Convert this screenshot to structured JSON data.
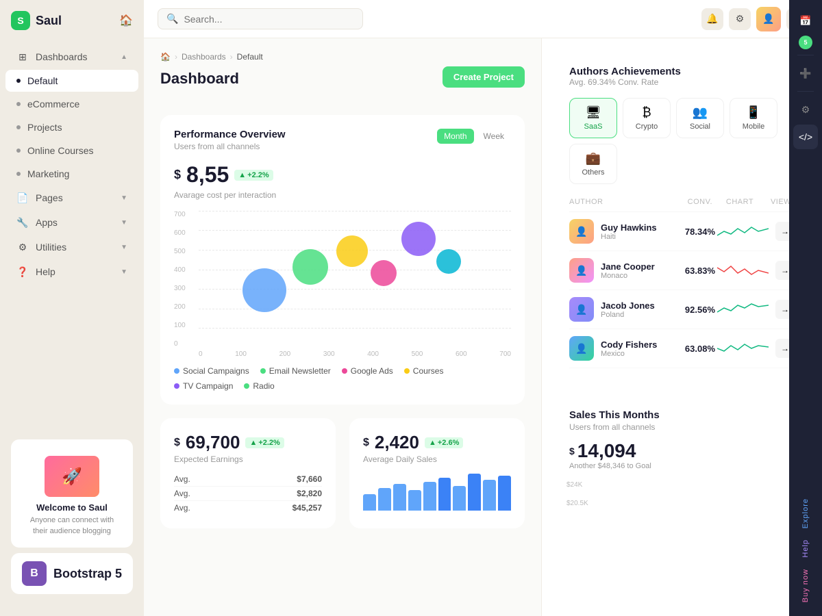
{
  "app": {
    "name": "Saul",
    "logo_letter": "S"
  },
  "sidebar": {
    "items": [
      {
        "id": "dashboards",
        "label": "Dashboards",
        "icon": "⊞",
        "type": "group",
        "expanded": true
      },
      {
        "id": "default",
        "label": "Default",
        "type": "child",
        "active": true
      },
      {
        "id": "ecommerce",
        "label": "eCommerce",
        "type": "child"
      },
      {
        "id": "projects",
        "label": "Projects",
        "type": "child"
      },
      {
        "id": "online-courses",
        "label": "Online Courses",
        "type": "child"
      },
      {
        "id": "marketing",
        "label": "Marketing",
        "type": "child"
      },
      {
        "id": "pages",
        "label": "Pages",
        "icon": "📄",
        "type": "group"
      },
      {
        "id": "apps",
        "label": "Apps",
        "icon": "🔧",
        "type": "group"
      },
      {
        "id": "utilities",
        "label": "Utilities",
        "icon": "⚙",
        "type": "group"
      },
      {
        "id": "help",
        "label": "Help",
        "icon": "❓",
        "type": "group"
      }
    ],
    "welcome": {
      "title": "Welcome to Saul",
      "subtitle": "Anyone can connect with their audience blogging"
    }
  },
  "topbar": {
    "search_placeholder": "Search...",
    "search_label": "Search _"
  },
  "breadcrumb": {
    "home": "🏠",
    "dashboards": "Dashboards",
    "current": "Default"
  },
  "page_title": "Dashboard",
  "create_btn": "Create Project",
  "performance": {
    "title": "Performance Overview",
    "subtitle": "Users from all channels",
    "tab_month": "Month",
    "tab_week": "Week",
    "value": "8,55",
    "currency": "$",
    "badge": "+2.2%",
    "avg_label": "Avarage cost per interaction",
    "y_labels": [
      "700",
      "600",
      "500",
      "400",
      "300",
      "200",
      "100",
      "0"
    ],
    "x_labels": [
      "0",
      "100",
      "200",
      "300",
      "400",
      "500",
      "600",
      "700"
    ],
    "bubbles": [
      {
        "color": "#60a5fa",
        "size": 64,
        "x": 18,
        "y": 38
      },
      {
        "color": "#4ade80",
        "size": 52,
        "x": 33,
        "y": 26
      },
      {
        "color": "#facc15",
        "size": 46,
        "x": 46,
        "y": 18
      },
      {
        "color": "#ec4899",
        "size": 38,
        "x": 57,
        "y": 30
      },
      {
        "color": "#8b5cf6",
        "size": 50,
        "x": 68,
        "y": 12
      },
      {
        "color": "#06b6d4",
        "size": 36,
        "x": 78,
        "y": 26
      }
    ],
    "legend": [
      {
        "label": "Social Campaigns",
        "color": "#60a5fa"
      },
      {
        "label": "Email Newsletter",
        "color": "#4ade80"
      },
      {
        "label": "Google Ads",
        "color": "#ec4899"
      },
      {
        "label": "Courses",
        "color": "#facc15"
      },
      {
        "label": "TV Campaign",
        "color": "#8b5cf6"
      },
      {
        "label": "Radio",
        "color": "#4ade80"
      }
    ]
  },
  "authors": {
    "title": "Authors Achievements",
    "subtitle": "Avg. 69.34% Conv. Rate",
    "categories": [
      {
        "id": "saas",
        "label": "SaaS",
        "icon": "🖥",
        "active": true
      },
      {
        "id": "crypto",
        "label": "Crypto",
        "icon": "₿"
      },
      {
        "id": "social",
        "label": "Social",
        "icon": "👥"
      },
      {
        "id": "mobile",
        "label": "Mobile",
        "icon": "📱"
      },
      {
        "id": "others",
        "label": "Others",
        "icon": "💼"
      }
    ],
    "columns": {
      "author": "AUTHOR",
      "conv": "CONV.",
      "chart": "CHART",
      "view": "VIEW"
    },
    "rows": [
      {
        "name": "Guy Hawkins",
        "location": "Haiti",
        "conv": "78.34%",
        "color": "#f6d365",
        "sparkline_color": "#10b981"
      },
      {
        "name": "Jane Cooper",
        "location": "Monaco",
        "conv": "63.83%",
        "color": "#fda085",
        "sparkline_color": "#ef4444"
      },
      {
        "name": "Jacob Jones",
        "location": "Poland",
        "conv": "92.56%",
        "color": "#a78bfa",
        "sparkline_color": "#10b981"
      },
      {
        "name": "Cody Fishers",
        "location": "Mexico",
        "conv": "63.08%",
        "color": "#60a5fa",
        "sparkline_color": "#10b981"
      }
    ]
  },
  "stats": {
    "earnings": {
      "currency": "$",
      "value": "69,700",
      "badge": "+2.2%",
      "label": "Expected Earnings"
    },
    "daily": {
      "currency": "$",
      "value": "2,420",
      "badge": "+2.6%",
      "label": "Average Daily Sales"
    },
    "table_rows": [
      {
        "label": "",
        "value": "$7,660"
      },
      {
        "label": "",
        "value": "$2,820"
      },
      {
        "label": "",
        "value": "$45,257"
      }
    ],
    "bars": [
      40,
      55,
      65,
      50,
      70,
      80,
      60,
      90,
      75,
      85
    ]
  },
  "sales": {
    "title": "Sales This Months",
    "subtitle": "Users from all channels",
    "currency": "$",
    "value": "14,094",
    "goal_text": "Another $48,346 to Goal",
    "y_labels": [
      "$24K",
      "$20.5K"
    ]
  },
  "icon_panel": {
    "explore_label": "Explore",
    "help_label": "Help",
    "buy_label": "Buy now"
  },
  "colors": {
    "green": "#4ade80",
    "dark": "#1a1a2e",
    "accent_blue": "#60a5fa",
    "purple": "#8b5cf6"
  }
}
